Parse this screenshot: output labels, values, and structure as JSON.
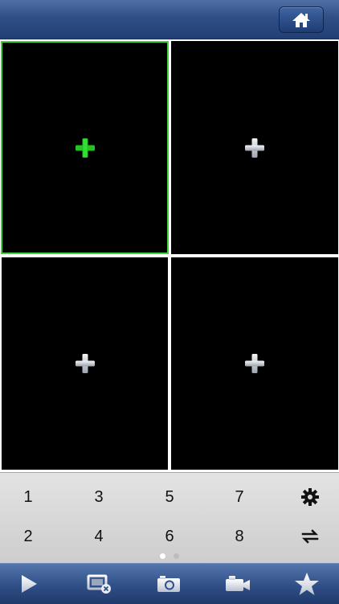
{
  "header": {
    "home_icon": "home-icon"
  },
  "grid": {
    "cells": [
      {
        "slot": 1,
        "state": "selected",
        "icon": "add-icon",
        "color": "#20c020"
      },
      {
        "slot": 2,
        "state": "empty",
        "icon": "add-icon",
        "color": "#c8ccd3"
      },
      {
        "slot": 3,
        "state": "empty",
        "icon": "add-icon",
        "color": "#c8ccd3"
      },
      {
        "slot": 4,
        "state": "empty",
        "icon": "add-icon",
        "color": "#c8ccd3"
      }
    ]
  },
  "keypad": {
    "row1": [
      "1",
      "3",
      "5",
      "7"
    ],
    "row2": [
      "2",
      "4",
      "6",
      "8"
    ],
    "settings_icon": "gear-icon",
    "swap_icon": "swap-arrows-icon"
  },
  "pager": {
    "pages": 2,
    "active_index": 0
  },
  "toolbar": {
    "items": [
      "play-icon",
      "close-stream-icon",
      "camera-icon",
      "video-camera-icon",
      "star-icon"
    ]
  },
  "colors": {
    "accent_blue": "#2f4f86",
    "selected_green": "#3bd43b"
  }
}
